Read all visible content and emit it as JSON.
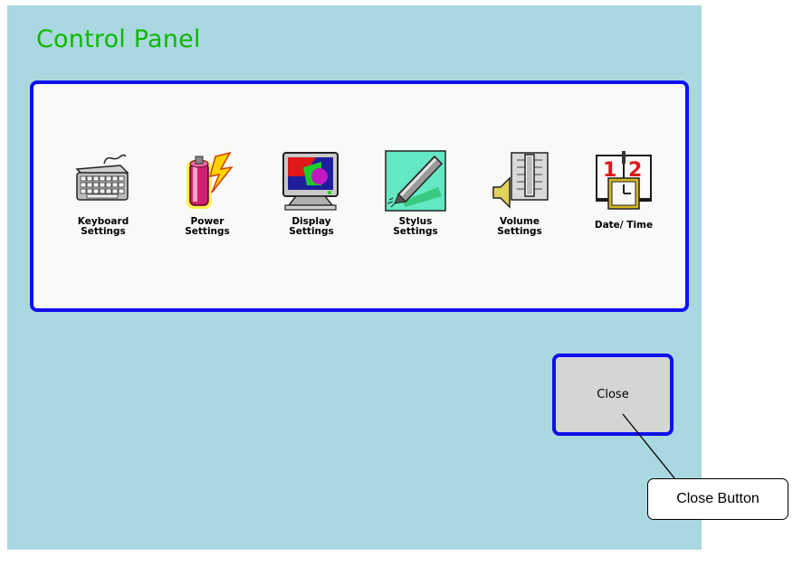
{
  "window": {
    "title": "Control Panel"
  },
  "items": [
    {
      "label_line1": "Keyboard",
      "label_line2": "Settings",
      "icon": "keyboard-icon"
    },
    {
      "label_line1": "Power",
      "label_line2": "Settings",
      "icon": "battery-power-icon"
    },
    {
      "label_line1": "Display",
      "label_line2": "Settings",
      "icon": "monitor-icon"
    },
    {
      "label_line1": "Stylus",
      "label_line2": "Settings",
      "icon": "stylus-pen-icon"
    },
    {
      "label_line1": "Volume",
      "label_line2": "Settings",
      "icon": "speaker-volume-icon"
    },
    {
      "label_line1": "Date/ Time",
      "icon": "calendar-clock-icon"
    }
  ],
  "close_button": {
    "label": "Close"
  },
  "annotation": {
    "label": "Close Button"
  },
  "colors": {
    "background": "#aad8e0",
    "title": "#0db800",
    "border": "#1010ee",
    "panel": "#f7faf6",
    "button": "#d4d6d4"
  }
}
